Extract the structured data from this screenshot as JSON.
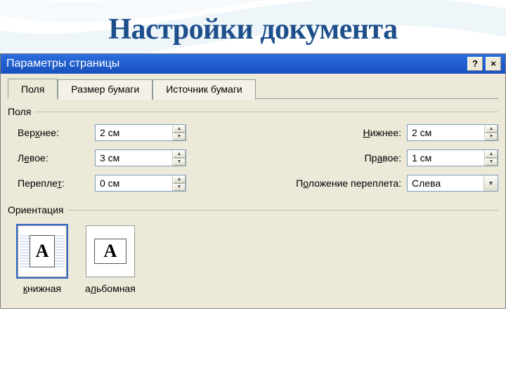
{
  "page": {
    "heading": "Настройки документа"
  },
  "dialog": {
    "title": "Параметры страницы",
    "help_btn": "?",
    "close_btn": "×"
  },
  "tabs": {
    "fields": "Поля",
    "paper_size": "Размер бумаги",
    "paper_source": "Источник бумаги",
    "active": 0
  },
  "margins": {
    "group_label": "Поля",
    "top_label": "Верхнее:",
    "top_value": "2 см",
    "bottom_label": "Нижнее:",
    "bottom_value": "2 см",
    "left_label": "Левое:",
    "left_value": "3 см",
    "right_label": "Правое:",
    "right_value": "1 см",
    "gutter_label": "Переплет:",
    "gutter_value": "0 см",
    "gutter_pos_label": "Положение переплета:",
    "gutter_pos_value": "Слева"
  },
  "orientation": {
    "group_label": "Ориентация",
    "portrait_label": "книжная",
    "landscape_label": "альбомная",
    "selected": "portrait",
    "thumb_glyph": "A"
  }
}
